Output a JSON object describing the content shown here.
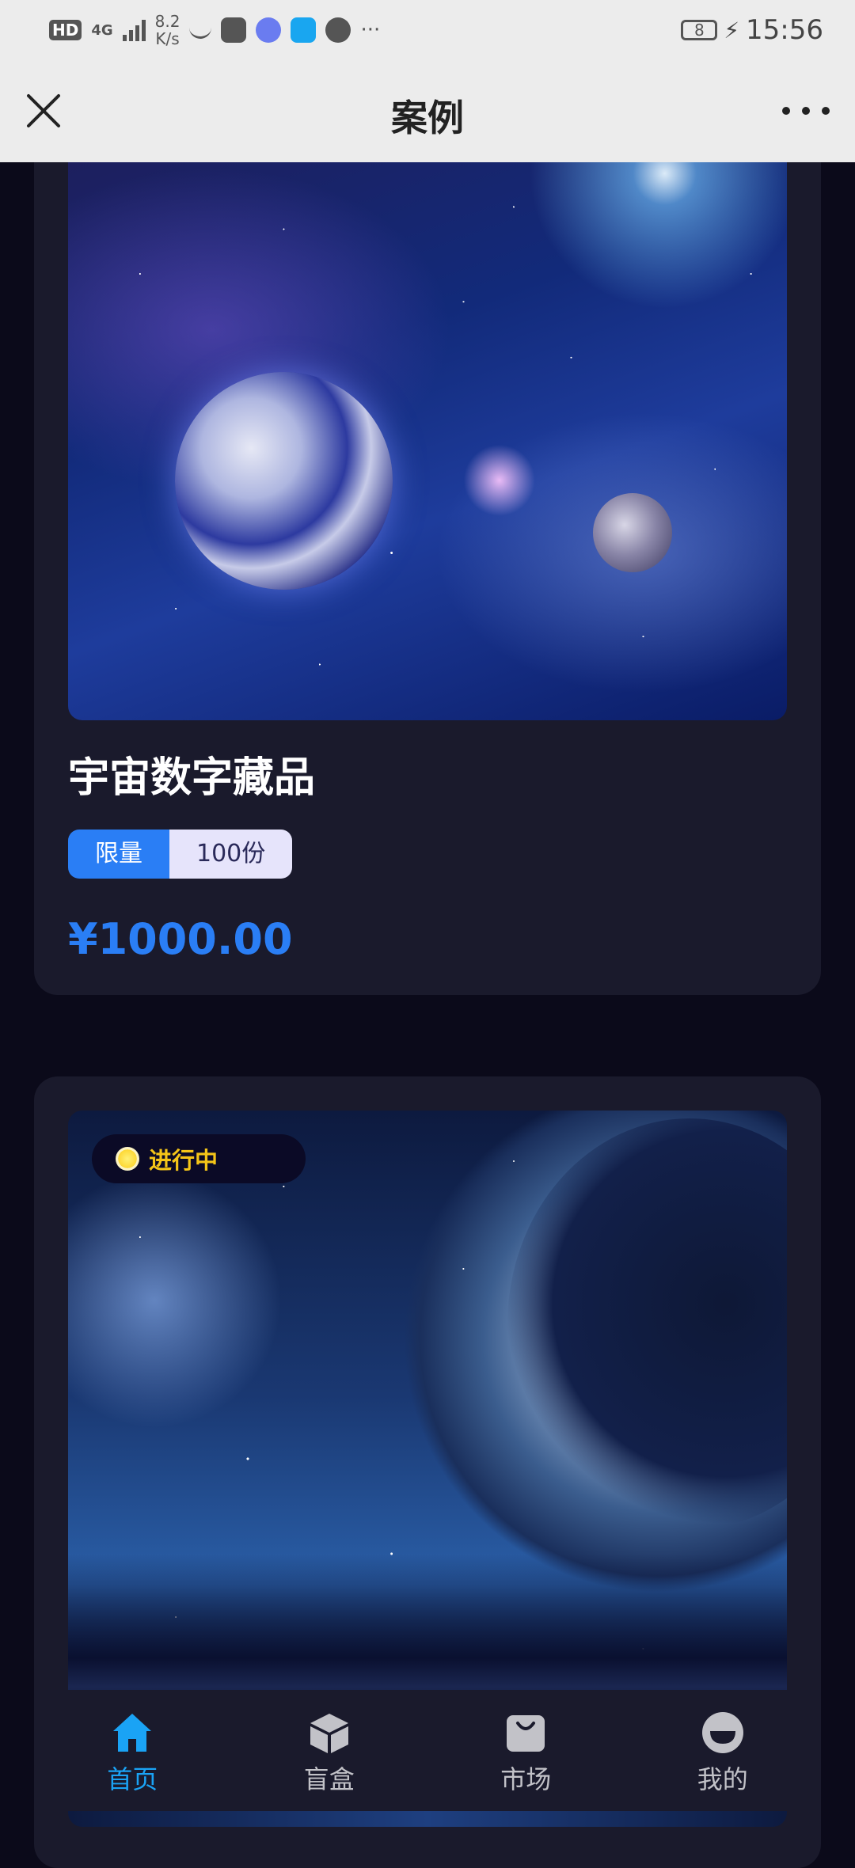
{
  "status_bar": {
    "hd": "HD",
    "signal": "4G",
    "speed_top": "8.2",
    "speed_bottom": "K/s",
    "more": "···",
    "battery": "8",
    "time": "15:56"
  },
  "nav": {
    "title": "案例"
  },
  "cards": [
    {
      "title": "宇宙数字藏品",
      "tag_label": "限量",
      "tag_value": "100份",
      "price": "¥1000.00"
    },
    {
      "status": "进行中"
    }
  ],
  "tabbar": {
    "items": [
      {
        "label": "首页",
        "icon": "home-icon",
        "active": true
      },
      {
        "label": "盲盒",
        "icon": "box-icon",
        "active": false
      },
      {
        "label": "市场",
        "icon": "bag-icon",
        "active": false
      },
      {
        "label": "我的",
        "icon": "profile-icon",
        "active": false
      }
    ]
  },
  "colors": {
    "accent": "#2a7ef5",
    "active_tab": "#1aa3f5",
    "status_pill_text": "#f5c518",
    "background": "#0b0a1a",
    "card": "#1a1a2c"
  }
}
